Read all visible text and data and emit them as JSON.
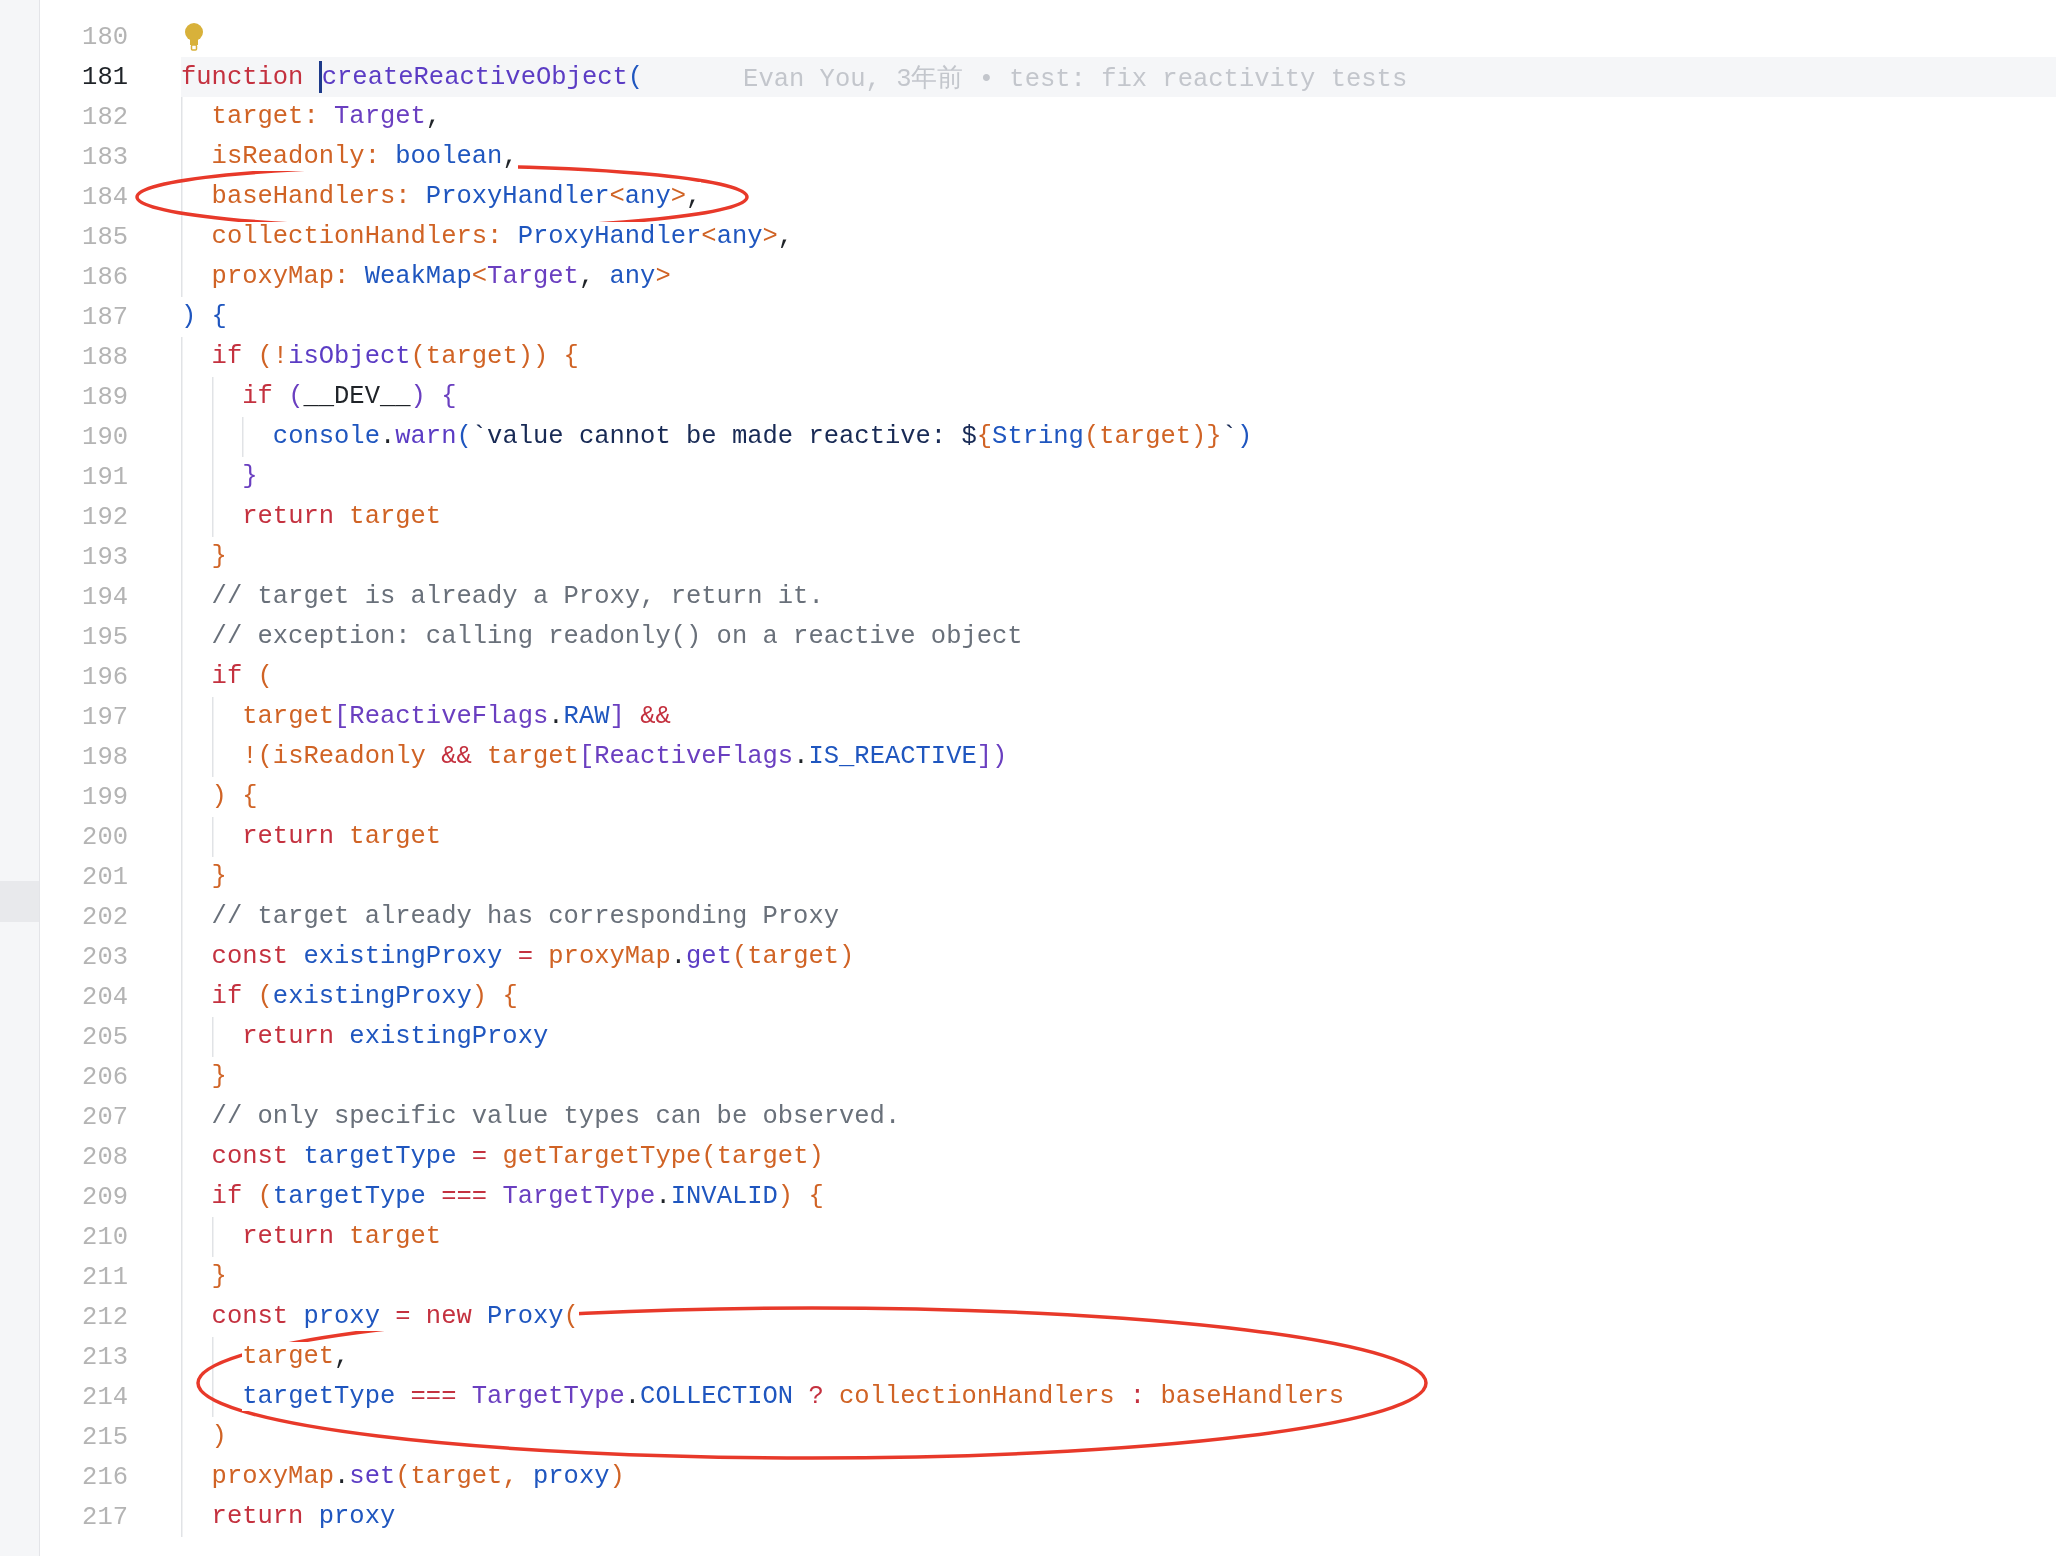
{
  "editor": {
    "lines": [
      {
        "number": "180",
        "current": false,
        "lightbulb": true
      },
      {
        "number": "181",
        "current": true,
        "blame": "Evan You, 3年前 • test: fix reactivity tests",
        "tokens": [
          {
            "kind": "kw",
            "text": "function "
          },
          {
            "kind": "func",
            "text": "createReactiveObject",
            "cursor_before": true
          },
          {
            "kind": "blue",
            "text": "("
          }
        ]
      },
      {
        "number": "182",
        "current": false,
        "tokens": [
          {
            "kind": "var",
            "text": "  target: "
          },
          {
            "kind": "type",
            "text": "Target"
          },
          {
            "kind": "plain",
            "text": ","
          }
        ]
      },
      {
        "number": "183",
        "current": false,
        "tokens": [
          {
            "kind": "var",
            "text": "  isReadonly: "
          },
          {
            "kind": "blue",
            "text": "boolean"
          },
          {
            "kind": "plain",
            "text": ","
          }
        ]
      },
      {
        "number": "184",
        "current": false,
        "tokens": [
          {
            "kind": "var",
            "text": "  baseHandlers: "
          },
          {
            "kind": "blue",
            "text": "ProxyHandler"
          },
          {
            "kind": "var",
            "text": "<"
          },
          {
            "kind": "blue",
            "text": "any"
          },
          {
            "kind": "var",
            "text": ">"
          },
          {
            "kind": "plain",
            "text": ","
          }
        ]
      },
      {
        "number": "185",
        "current": false,
        "tokens": [
          {
            "kind": "var",
            "text": "  collectionHandlers: "
          },
          {
            "kind": "blue",
            "text": "ProxyHandler"
          },
          {
            "kind": "var",
            "text": "<"
          },
          {
            "kind": "blue",
            "text": "any"
          },
          {
            "kind": "var",
            "text": ">"
          },
          {
            "kind": "plain",
            "text": ","
          }
        ]
      },
      {
        "number": "186",
        "current": false,
        "tokens": [
          {
            "kind": "var",
            "text": "  proxyMap: "
          },
          {
            "kind": "blue",
            "text": "WeakMap"
          },
          {
            "kind": "var",
            "text": "<"
          },
          {
            "kind": "type",
            "text": "Target"
          },
          {
            "kind": "plain",
            "text": ", "
          },
          {
            "kind": "blue",
            "text": "any"
          },
          {
            "kind": "var",
            "text": ">"
          }
        ]
      },
      {
        "number": "187",
        "current": false,
        "tokens": [
          {
            "kind": "blue",
            "text": ") {"
          }
        ]
      },
      {
        "number": "188",
        "current": false,
        "tokens": [
          {
            "kind": "kw",
            "text": "  if "
          },
          {
            "kind": "var",
            "text": "(!"
          },
          {
            "kind": "func",
            "text": "isObject"
          },
          {
            "kind": "var",
            "text": "(target)) {"
          }
        ]
      },
      {
        "number": "189",
        "current": false,
        "tokens": [
          {
            "kind": "kw",
            "text": "    if "
          },
          {
            "kind": "type",
            "text": "("
          },
          {
            "kind": "plain",
            "text": "__DEV__"
          },
          {
            "kind": "type",
            "text": ") {"
          }
        ]
      },
      {
        "number": "190",
        "current": false,
        "tokens": [
          {
            "kind": "blue",
            "text": "      console"
          },
          {
            "kind": "plain",
            "text": "."
          },
          {
            "kind": "func",
            "text": "warn"
          },
          {
            "kind": "blue",
            "text": "("
          },
          {
            "kind": "str",
            "text": "`value cannot be made reactive: $"
          },
          {
            "kind": "var",
            "text": "{"
          },
          {
            "kind": "blue",
            "text": "String"
          },
          {
            "kind": "var",
            "text": "(target)}"
          },
          {
            "kind": "str",
            "text": "`"
          },
          {
            "kind": "blue",
            "text": ")"
          }
        ]
      },
      {
        "number": "191",
        "current": false,
        "tokens": [
          {
            "kind": "type",
            "text": "    }"
          }
        ]
      },
      {
        "number": "192",
        "current": false,
        "tokens": [
          {
            "kind": "kw",
            "text": "    return "
          },
          {
            "kind": "var",
            "text": "target"
          }
        ]
      },
      {
        "number": "193",
        "current": false,
        "tokens": [
          {
            "kind": "var",
            "text": "  }"
          }
        ]
      },
      {
        "number": "194",
        "current": false,
        "tokens": [
          {
            "kind": "comment",
            "text": "  // target is already a Proxy, return it."
          }
        ]
      },
      {
        "number": "195",
        "current": false,
        "tokens": [
          {
            "kind": "comment",
            "text": "  // exception: calling readonly() on a reactive object"
          }
        ]
      },
      {
        "number": "196",
        "current": false,
        "tokens": [
          {
            "kind": "kw",
            "text": "  if "
          },
          {
            "kind": "var",
            "text": "("
          }
        ]
      },
      {
        "number": "197",
        "current": false,
        "tokens": [
          {
            "kind": "var",
            "text": "    target"
          },
          {
            "kind": "type",
            "text": "[ReactiveFlags"
          },
          {
            "kind": "plain",
            "text": "."
          },
          {
            "kind": "blue",
            "text": "RAW"
          },
          {
            "kind": "type",
            "text": "]"
          },
          {
            "kind": "kw",
            "text": " &&"
          }
        ]
      },
      {
        "number": "198",
        "current": false,
        "tokens": [
          {
            "kind": "var",
            "text": "    !(isReadonly "
          },
          {
            "kind": "kw",
            "text": "&&"
          },
          {
            "kind": "var",
            "text": " target"
          },
          {
            "kind": "type",
            "text": "[ReactiveFlags"
          },
          {
            "kind": "plain",
            "text": "."
          },
          {
            "kind": "blue",
            "text": "IS_REACTIVE"
          },
          {
            "kind": "type",
            "text": "])"
          }
        ]
      },
      {
        "number": "199",
        "current": false,
        "tokens": [
          {
            "kind": "var",
            "text": "  ) {"
          }
        ]
      },
      {
        "number": "200",
        "current": false,
        "tokens": [
          {
            "kind": "kw",
            "text": "    return "
          },
          {
            "kind": "var",
            "text": "target"
          }
        ]
      },
      {
        "number": "201",
        "current": false,
        "tokens": [
          {
            "kind": "var",
            "text": "  }"
          }
        ]
      },
      {
        "number": "202",
        "current": false,
        "tokens": [
          {
            "kind": "comment",
            "text": "  // target already has corresponding Proxy"
          }
        ]
      },
      {
        "number": "203",
        "current": false,
        "tokens": [
          {
            "kind": "kw",
            "text": "  const "
          },
          {
            "kind": "blue",
            "text": "existingProxy"
          },
          {
            "kind": "kw",
            "text": " = "
          },
          {
            "kind": "var",
            "text": "proxyMap"
          },
          {
            "kind": "plain",
            "text": "."
          },
          {
            "kind": "func",
            "text": "get"
          },
          {
            "kind": "var",
            "text": "(target)"
          }
        ]
      },
      {
        "number": "204",
        "current": false,
        "tokens": [
          {
            "kind": "kw",
            "text": "  if "
          },
          {
            "kind": "var",
            "text": "("
          },
          {
            "kind": "blue",
            "text": "existingProxy"
          },
          {
            "kind": "var",
            "text": ") {"
          }
        ]
      },
      {
        "number": "205",
        "current": false,
        "tokens": [
          {
            "kind": "kw",
            "text": "    return "
          },
          {
            "kind": "blue",
            "text": "existingProxy"
          }
        ]
      },
      {
        "number": "206",
        "current": false,
        "tokens": [
          {
            "kind": "var",
            "text": "  }"
          }
        ]
      },
      {
        "number": "207",
        "current": false,
        "tokens": [
          {
            "kind": "comment",
            "text": "  // only specific value types can be observed."
          }
        ]
      },
      {
        "number": "208",
        "current": false,
        "tokens": [
          {
            "kind": "kw",
            "text": "  const "
          },
          {
            "kind": "blue",
            "text": "targetType"
          },
          {
            "kind": "kw",
            "text": " = "
          },
          {
            "kind": "var",
            "text": "getTargetType(target)"
          }
        ]
      },
      {
        "number": "209",
        "current": false,
        "tokens": [
          {
            "kind": "kw",
            "text": "  if "
          },
          {
            "kind": "var",
            "text": "("
          },
          {
            "kind": "blue",
            "text": "targetType"
          },
          {
            "kind": "kw",
            "text": " === "
          },
          {
            "kind": "type",
            "text": "TargetType"
          },
          {
            "kind": "plain",
            "text": "."
          },
          {
            "kind": "blue",
            "text": "INVALID"
          },
          {
            "kind": "var",
            "text": ") {"
          }
        ]
      },
      {
        "number": "210",
        "current": false,
        "tokens": [
          {
            "kind": "kw",
            "text": "    return "
          },
          {
            "kind": "var",
            "text": "target"
          }
        ]
      },
      {
        "number": "211",
        "current": false,
        "tokens": [
          {
            "kind": "var",
            "text": "  }"
          }
        ]
      },
      {
        "number": "212",
        "current": false,
        "tokens": [
          {
            "kind": "kw",
            "text": "  const "
          },
          {
            "kind": "blue",
            "text": "proxy"
          },
          {
            "kind": "kw",
            "text": " = new "
          },
          {
            "kind": "blue",
            "text": "Proxy"
          },
          {
            "kind": "var",
            "text": "("
          }
        ]
      },
      {
        "number": "213",
        "current": false,
        "tokens": [
          {
            "kind": "var",
            "text": "    target"
          },
          {
            "kind": "plain",
            "text": ","
          }
        ]
      },
      {
        "number": "214",
        "current": false,
        "tokens": [
          {
            "kind": "blue",
            "text": "    targetType"
          },
          {
            "kind": "kw",
            "text": " === "
          },
          {
            "kind": "type",
            "text": "TargetType"
          },
          {
            "kind": "plain",
            "text": "."
          },
          {
            "kind": "blue",
            "text": "COLLECTION"
          },
          {
            "kind": "kw",
            "text": " ? "
          },
          {
            "kind": "var",
            "text": "collectionHandlers"
          },
          {
            "kind": "kw",
            "text": " : "
          },
          {
            "kind": "var",
            "text": "baseHandlers"
          }
        ]
      },
      {
        "number": "215",
        "current": false,
        "tokens": [
          {
            "kind": "var",
            "text": "  )"
          }
        ]
      },
      {
        "number": "216",
        "current": false,
        "tokens": [
          {
            "kind": "var",
            "text": "  proxyMap"
          },
          {
            "kind": "plain",
            "text": "."
          },
          {
            "kind": "func",
            "text": "set"
          },
          {
            "kind": "var",
            "text": "(target, "
          },
          {
            "kind": "blue",
            "text": "proxy"
          },
          {
            "kind": "var",
            "text": ")"
          }
        ]
      },
      {
        "number": "217",
        "current": false,
        "tokens": [
          {
            "kind": "kw",
            "text": "  return "
          },
          {
            "kind": "blue",
            "text": "proxy"
          }
        ]
      }
    ]
  }
}
